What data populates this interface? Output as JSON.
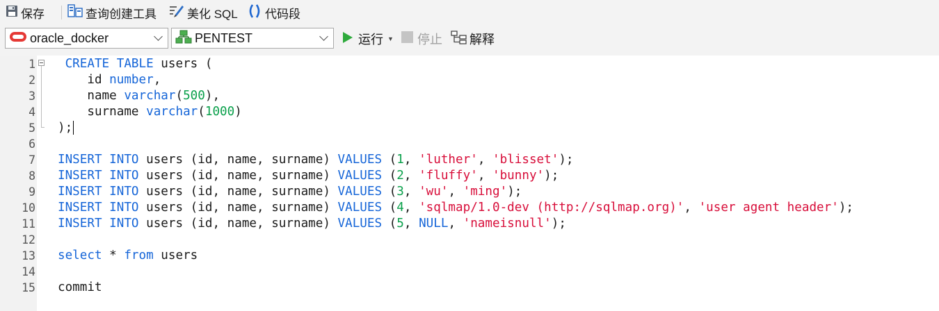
{
  "toolbar": {
    "save": "保存",
    "query_builder": "查询创建工具",
    "beautify": "美化 SQL",
    "snippet": "代码段"
  },
  "connection_bar": {
    "connection": "oracle_docker",
    "schema": "PENTEST",
    "run": "运行",
    "stop": "停止",
    "explain": "解释"
  },
  "editor": {
    "line_numbers": [
      "1",
      "2",
      "3",
      "4",
      "5",
      "6",
      "7",
      "8",
      "9",
      "10",
      "11",
      "12",
      "13",
      "14",
      "15"
    ],
    "lines": [
      [
        {
          "t": " "
        },
        {
          "t": "CREATE TABLE",
          "c": "kw"
        },
        {
          "t": " users ("
        }
      ],
      [
        {
          "t": "    id "
        },
        {
          "t": "number",
          "c": "kw"
        },
        {
          "t": ","
        }
      ],
      [
        {
          "t": "    name "
        },
        {
          "t": "varchar",
          "c": "kw"
        },
        {
          "t": "("
        },
        {
          "t": "500",
          "c": "num"
        },
        {
          "t": "),"
        }
      ],
      [
        {
          "t": "    surname "
        },
        {
          "t": "varchar",
          "c": "kw"
        },
        {
          "t": "("
        },
        {
          "t": "1000",
          "c": "num"
        },
        {
          "t": ")"
        }
      ],
      [
        {
          "t": ");"
        }
      ],
      [],
      [
        {
          "t": "INSERT INTO",
          "c": "kw"
        },
        {
          "t": " users (id, name, surname) "
        },
        {
          "t": "VALUES",
          "c": "kw"
        },
        {
          "t": " ("
        },
        {
          "t": "1",
          "c": "num"
        },
        {
          "t": ", "
        },
        {
          "t": "'luther'",
          "c": "str"
        },
        {
          "t": ", "
        },
        {
          "t": "'blisset'",
          "c": "str"
        },
        {
          "t": ");"
        }
      ],
      [
        {
          "t": "INSERT INTO",
          "c": "kw"
        },
        {
          "t": " users (id, name, surname) "
        },
        {
          "t": "VALUES",
          "c": "kw"
        },
        {
          "t": " ("
        },
        {
          "t": "2",
          "c": "num"
        },
        {
          "t": ", "
        },
        {
          "t": "'fluffy'",
          "c": "str"
        },
        {
          "t": ", "
        },
        {
          "t": "'bunny'",
          "c": "str"
        },
        {
          "t": ");"
        }
      ],
      [
        {
          "t": "INSERT INTO",
          "c": "kw"
        },
        {
          "t": " users (id, name, surname) "
        },
        {
          "t": "VALUES",
          "c": "kw"
        },
        {
          "t": " ("
        },
        {
          "t": "3",
          "c": "num"
        },
        {
          "t": ", "
        },
        {
          "t": "'wu'",
          "c": "str"
        },
        {
          "t": ", "
        },
        {
          "t": "'ming'",
          "c": "str"
        },
        {
          "t": ");"
        }
      ],
      [
        {
          "t": "INSERT INTO",
          "c": "kw"
        },
        {
          "t": " users (id, name, surname) "
        },
        {
          "t": "VALUES",
          "c": "kw"
        },
        {
          "t": " ("
        },
        {
          "t": "4",
          "c": "num"
        },
        {
          "t": ", "
        },
        {
          "t": "'sqlmap/1.0-dev (http://sqlmap.org)'",
          "c": "str"
        },
        {
          "t": ", "
        },
        {
          "t": "'user agent header'",
          "c": "str"
        },
        {
          "t": ");"
        }
      ],
      [
        {
          "t": "INSERT INTO",
          "c": "kw"
        },
        {
          "t": " users (id, name, surname) "
        },
        {
          "t": "VALUES",
          "c": "kw"
        },
        {
          "t": " ("
        },
        {
          "t": "5",
          "c": "num"
        },
        {
          "t": ", "
        },
        {
          "t": "NULL",
          "c": "kw"
        },
        {
          "t": ", "
        },
        {
          "t": "'nameisnull'",
          "c": "str"
        },
        {
          "t": ");"
        }
      ],
      [],
      [
        {
          "t": "select",
          "c": "kw"
        },
        {
          "t": " * "
        },
        {
          "t": "from",
          "c": "kw"
        },
        {
          "t": " users"
        }
      ],
      [],
      [
        {
          "t": "commit"
        }
      ]
    ]
  },
  "colors": {
    "keyword": "#1565d8",
    "number": "#0aa04b",
    "string": "#d80e3a",
    "run_icon": "#2eaa3c",
    "connection_icon": "#e53935"
  },
  "icons": [
    "floppy-disk-icon",
    "query-builder-icon",
    "beautify-brush-icon",
    "code-snippet-icon",
    "oracle-db-icon",
    "schema-icon",
    "play-icon",
    "stop-icon",
    "explain-icon",
    "fold-toggle-icon"
  ]
}
